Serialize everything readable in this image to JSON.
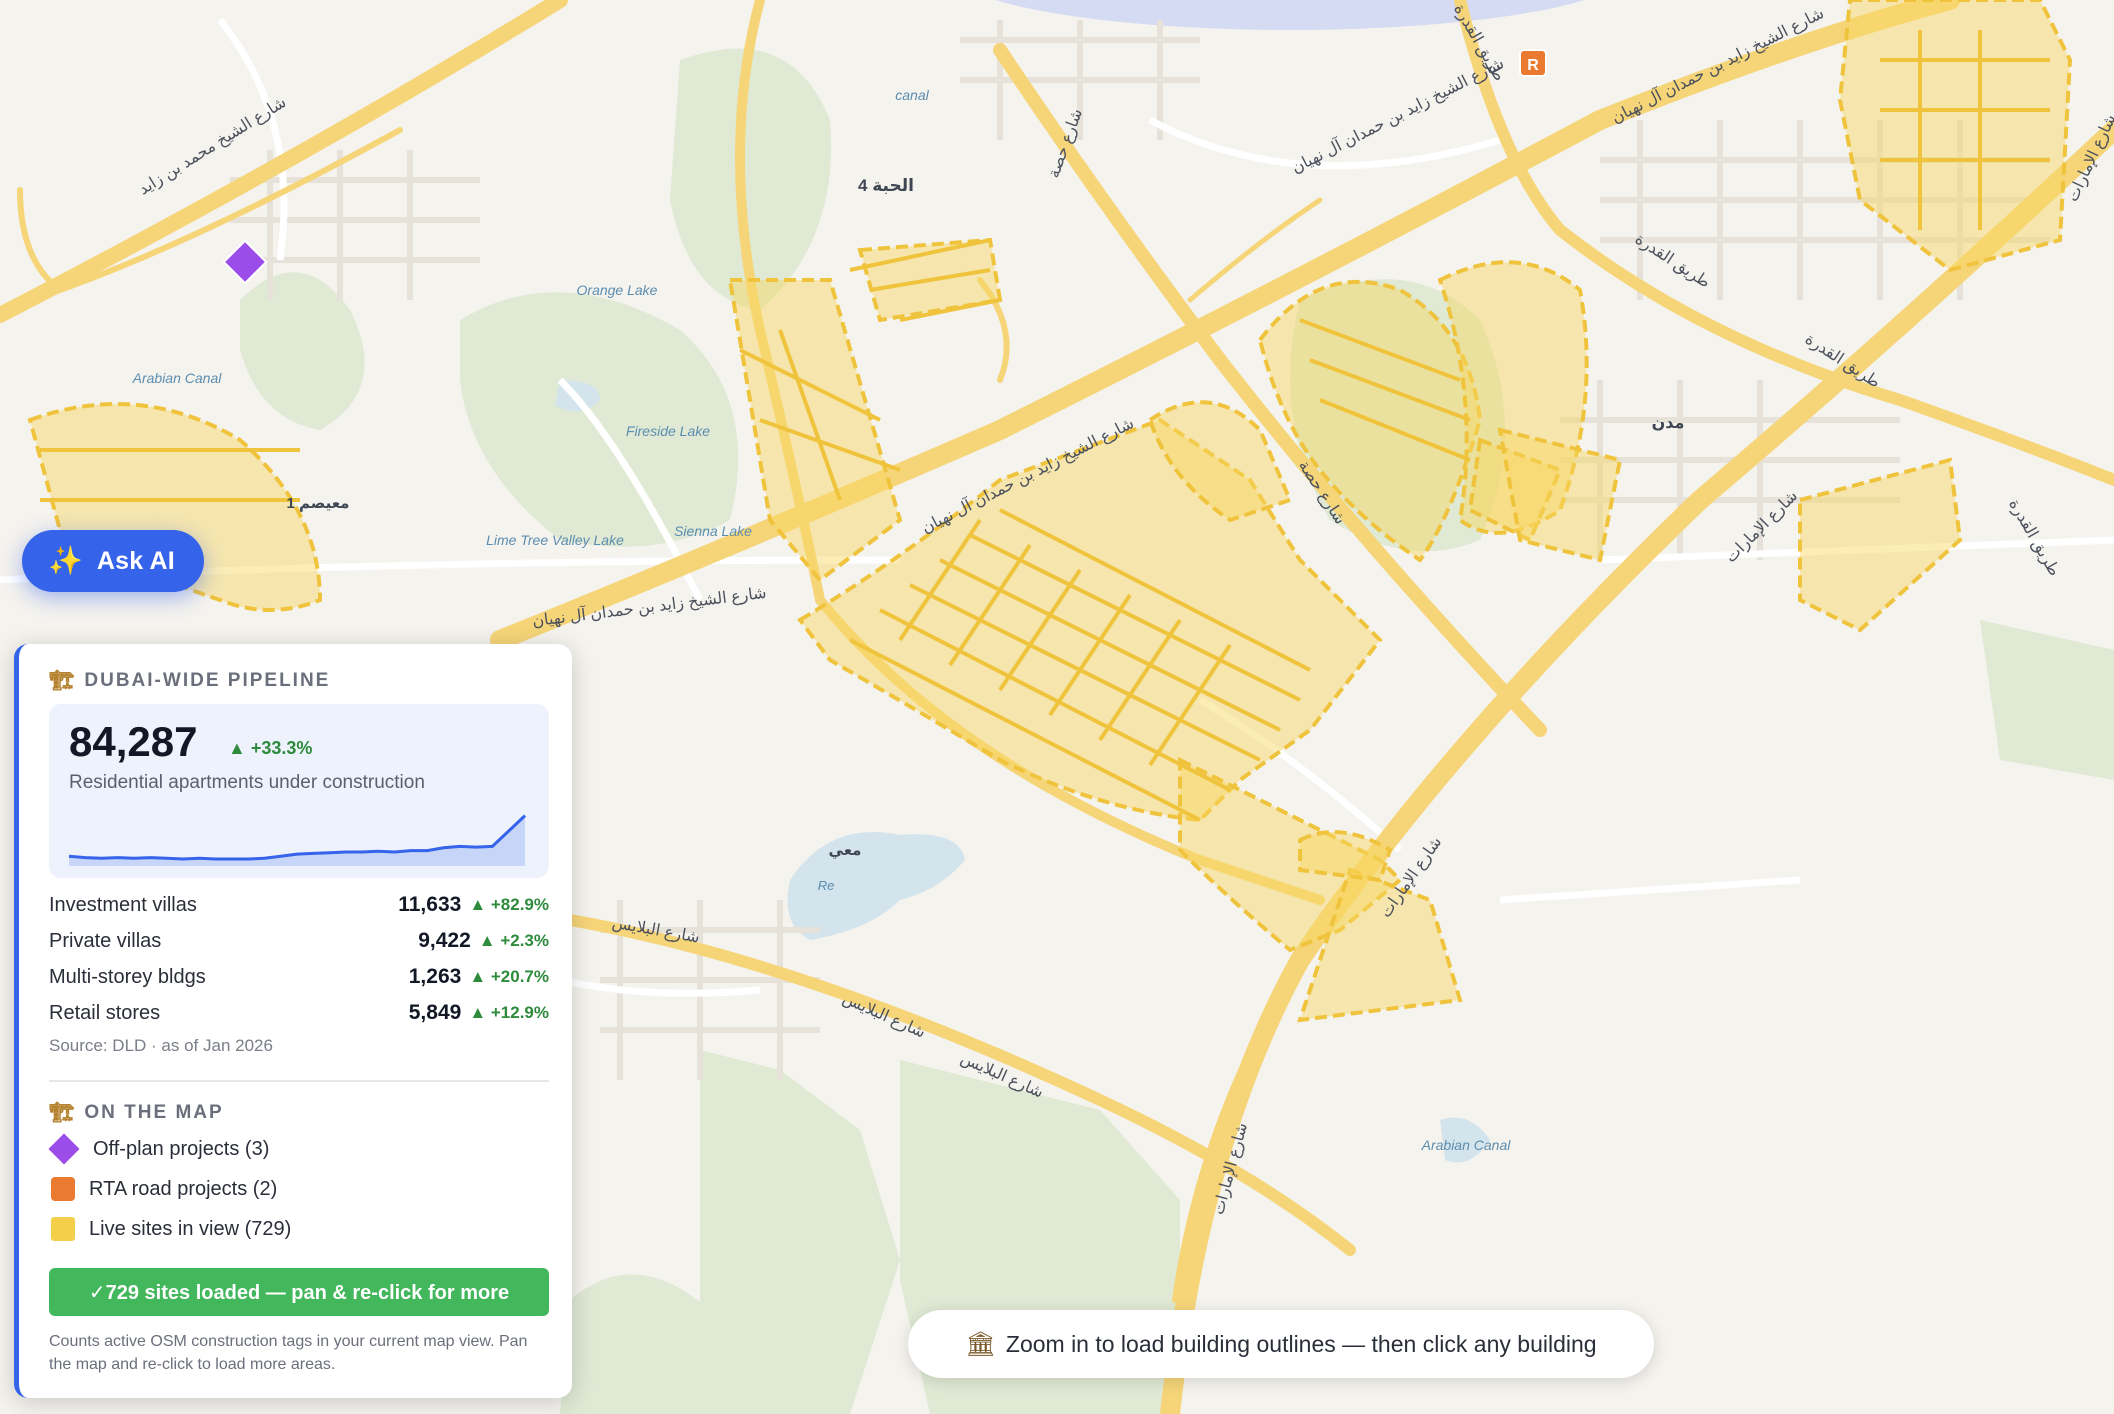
{
  "map": {
    "labels": {
      "al_hebiah_4": "الحبة 4",
      "canal": "canal",
      "orange_lake": "Orange Lake",
      "arabian_canal_west": "Arabian Canal",
      "fireside_lake": "Fireside Lake",
      "lime_tree_valley": "Lime Tree Valley Lake",
      "sienna_lake": "Sienna Lake",
      "maaisem_1": "معيصم 1",
      "mudon": "مدن",
      "maa": "معي",
      "re": "Re",
      "arabian_canal_east": "Arabian Canal",
      "road_mohammed_bin_zayed": "شارع الشيخ محمد بن زايد",
      "road_zayed_bin_hamdan_1": "شارع الشيخ زايد بن حمدان آل نهيان",
      "road_zayed_bin_hamdan_2": "شارع الشيخ زايد بن حمدان آل نهيان",
      "road_zayed_bin_hamdan_3": "شارع الشيخ زايد بن حمدان آل نهيان",
      "road_zayed_bin_hamdan_4": "شارع الشيخ زايد بن حمدان آل نهيان",
      "road_hessa_1": "شارع حصة",
      "road_hessa_2": "شارع حصة",
      "road_qudra_1": "طريق القدرة",
      "road_qudra_2": "طريق القدرة",
      "road_qudra_3": "طريق القدرة",
      "road_qudra_4": "طريق القدرة",
      "road_emirates_1": "شارع الإمارات",
      "road_emirates_2": "شارع الإمارات",
      "road_emirates_3": "شارع الإمارات",
      "road_emirates_4": "شارع الإمارات",
      "road_palace_1": "شارع البلايس",
      "road_palace_2": "شارع البلايس",
      "road_palace_3": "شارع البلايس"
    },
    "rta_marker_letter": "R",
    "colors": {
      "background": "#f5f3ee",
      "major_road": "#f6d579",
      "minor_road": "#ffffff",
      "park": "#dfe9d4",
      "water": "#d4e4ec",
      "site_fill": "#f8d65f",
      "site_stroke": "#f0c33c",
      "offplan": "#9b4dea",
      "rta": "#ea7a2f"
    }
  },
  "ask_ai": {
    "icon": "sparkles-icon",
    "label": "Ask AI"
  },
  "pipeline": {
    "title": "DUBAI-WIDE PIPELINE",
    "headline": {
      "value": "84,287",
      "delta": "▲ +33.3%",
      "subtitle": "Residential apartments under construction",
      "trend": [
        0.14,
        0.12,
        0.11,
        0.12,
        0.11,
        0.12,
        0.11,
        0.1,
        0.11,
        0.1,
        0.1,
        0.1,
        0.11,
        0.14,
        0.17,
        0.18,
        0.19,
        0.2,
        0.2,
        0.21,
        0.2,
        0.22,
        0.22,
        0.26,
        0.28,
        0.27,
        0.28,
        0.5,
        0.72
      ]
    },
    "rows": [
      {
        "name": "Investment villas",
        "value": "11,633",
        "delta": "▲ +82.9%"
      },
      {
        "name": "Private villas",
        "value": "9,422",
        "delta": "▲ +2.3%"
      },
      {
        "name": "Multi-storey bldgs",
        "value": "1,263",
        "delta": "▲ +20.7%"
      },
      {
        "name": "Retail stores",
        "value": "5,849",
        "delta": "▲ +12.9%"
      }
    ],
    "source": "Source: DLD · as of Jan 2026"
  },
  "on_the_map": {
    "title": "ON THE MAP",
    "items": [
      {
        "icon": "purple-diamond-icon",
        "label": "Off-plan projects (3)"
      },
      {
        "icon": "orange-square-icon",
        "label": "RTA road projects (2)"
      },
      {
        "icon": "yellow-square-icon",
        "label": "Live sites in view (729)"
      }
    ]
  },
  "load_button": {
    "label": "✓729 sites loaded — pan & re-click for more"
  },
  "note": "Counts active OSM construction tags in your current map view. Pan the map and re-click to load more areas.",
  "toast": {
    "icon": "museum-icon",
    "text": "Zoom in to load building outlines — then click any building"
  }
}
